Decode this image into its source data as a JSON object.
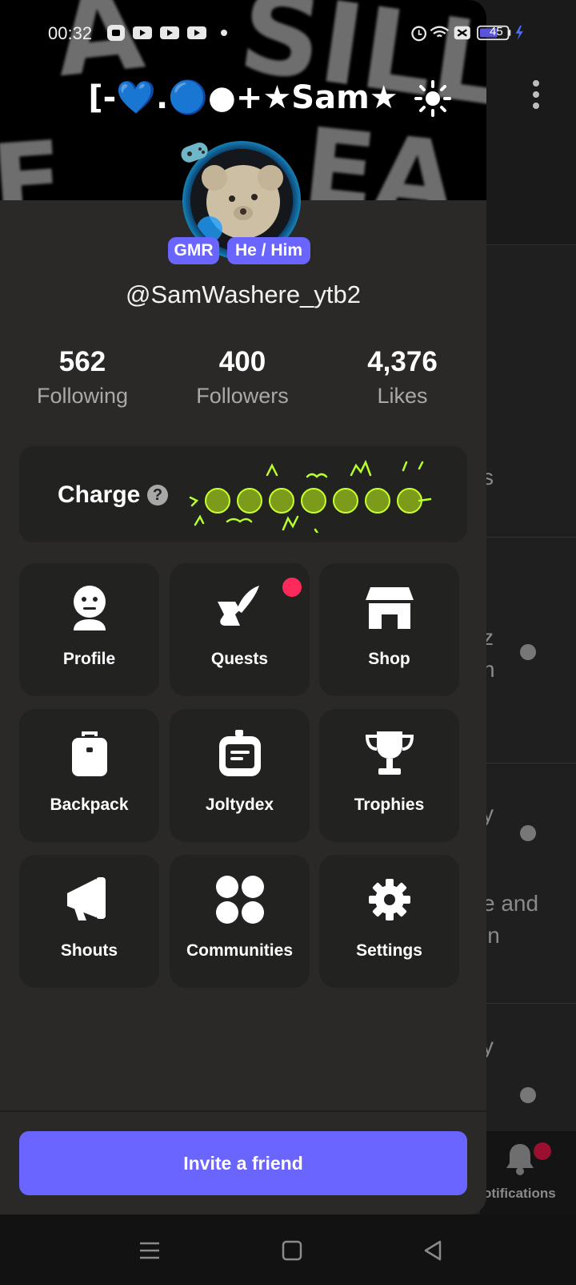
{
  "status_bar": {
    "time": "00:32",
    "battery": "45"
  },
  "background": {
    "partial_texts": [
      "s",
      "z",
      "n",
      "y",
      "e and",
      "in",
      "y"
    ],
    "notifications_label": "otifications"
  },
  "profile": {
    "display_name": "[-💙.🔵●+★Sam★",
    "tags": [
      "GMR",
      "He / Him"
    ],
    "username": "@SamWashere_ytb2",
    "stats": [
      {
        "value": "562",
        "label": "Following"
      },
      {
        "value": "400",
        "label": "Followers"
      },
      {
        "value": "4,376",
        "label": "Likes"
      }
    ],
    "charge_label": "Charge",
    "charge_help": "?"
  },
  "menu": [
    {
      "label": "Profile",
      "icon": "profile-icon"
    },
    {
      "label": "Quests",
      "icon": "quests-icon",
      "badge": true
    },
    {
      "label": "Shop",
      "icon": "shop-icon"
    },
    {
      "label": "Backpack",
      "icon": "backpack-icon"
    },
    {
      "label": "Joltydex",
      "icon": "joltydex-icon"
    },
    {
      "label": "Trophies",
      "icon": "trophy-icon"
    },
    {
      "label": "Shouts",
      "icon": "megaphone-icon"
    },
    {
      "label": "Communities",
      "icon": "communities-icon"
    },
    {
      "label": "Settings",
      "icon": "gear-icon"
    }
  ],
  "invite_label": "Invite a friend",
  "colors": {
    "accent": "#6b65ff",
    "badge": "#ff2a5c",
    "drawer_bg": "#2a2927",
    "tile_bg": "#222220"
  }
}
